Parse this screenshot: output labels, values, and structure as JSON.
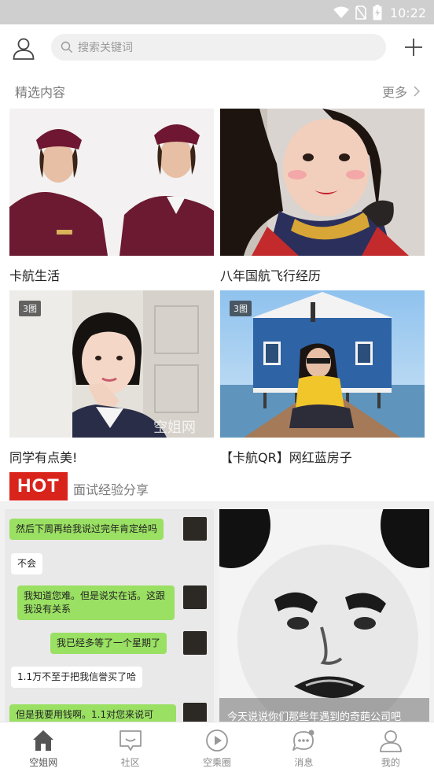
{
  "status_bar": {
    "time": "10:22"
  },
  "header": {
    "search_placeholder": "搜索关键词"
  },
  "featured": {
    "title": "精选内容",
    "more_label": "更多",
    "cards": [
      {
        "caption": "卡航生活",
        "badge": ""
      },
      {
        "caption": "八年国航飞行经历",
        "badge": ""
      },
      {
        "caption": "同学有点美!",
        "badge": "3图",
        "watermark": "空姐网"
      },
      {
        "caption": "【卡航QR】网红蓝房子",
        "badge": "3图"
      }
    ]
  },
  "hot": {
    "badge": "HOT",
    "title": "面试经验分享",
    "chat_messages": [
      {
        "side": "right",
        "text": "然后下周再给我说过完年肯定给吗"
      },
      {
        "side": "left",
        "text": "不会"
      },
      {
        "side": "right",
        "text": "我知道您难。但是说实在话。这跟我没有关系"
      },
      {
        "side": "right",
        "text": "我已经多等了一个星期了"
      },
      {
        "side": "left",
        "text": "1.1万不至于把我信誉买了哈"
      },
      {
        "side": "right",
        "text": "但是我要用钱啊。1.1对您来说可"
      }
    ],
    "meme_caption": "今天说说你们那些年遇到的奇葩公司吧"
  },
  "bottom_nav": [
    {
      "label": "空姐网",
      "icon": "home-icon",
      "active": true
    },
    {
      "label": "社区",
      "icon": "community-icon",
      "active": false
    },
    {
      "label": "空乘圈",
      "icon": "play-circle-icon",
      "active": false
    },
    {
      "label": "消息",
      "icon": "message-icon",
      "active": false
    },
    {
      "label": "我的",
      "icon": "profile-icon",
      "active": false
    }
  ],
  "colors": {
    "hot_red": "#d9241c",
    "status_bar": "#cfcfcf",
    "chat_green": "#9ae063"
  }
}
